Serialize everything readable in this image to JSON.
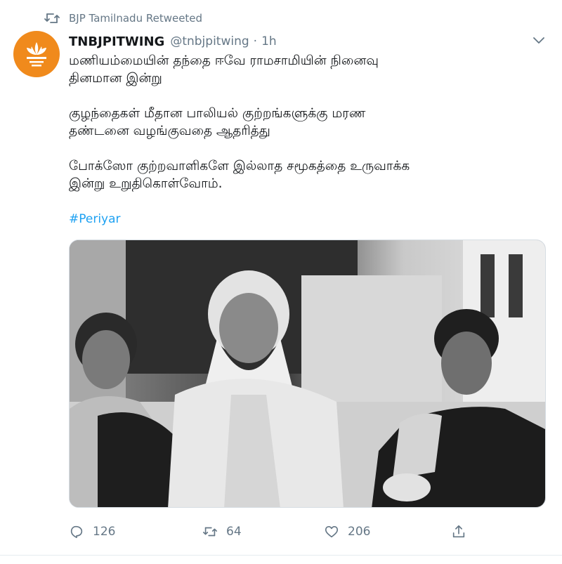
{
  "retweet_context": {
    "label": "BJP Tamilnadu Retweeted",
    "icon": "retweet-icon"
  },
  "author": {
    "display_name": "TNBJPITWING",
    "handle": "@tnbjpitwing",
    "separator": "·",
    "time": "1h",
    "avatar_icon": "bjp-lotus-logo",
    "avatar_color": "#f08a1c"
  },
  "tweet": {
    "lines": [
      "மணியம்மையின் தந்தை ஈவே ராமசாமியின் நினைவு",
      "தினமான இன்று",
      "குழந்தைகள் மீதான பாலியல் குற்றங்களுக்கு மரண",
      "தண்டனை வழங்குவதை ஆதரித்து",
      "போக்ஸோ குற்றவாளிகளே இல்லாத சமூகத்தை உருவாக்க",
      "இன்று உறுதிகொள்வோம்."
    ],
    "hashtag": "#Periyar"
  },
  "media": {
    "description_icon": "black-and-white-photo"
  },
  "actions": {
    "reply_count": "126",
    "retweet_count": "64",
    "like_count": "206"
  },
  "colors": {
    "link": "#1da1f2",
    "secondary_text": "#657786"
  }
}
